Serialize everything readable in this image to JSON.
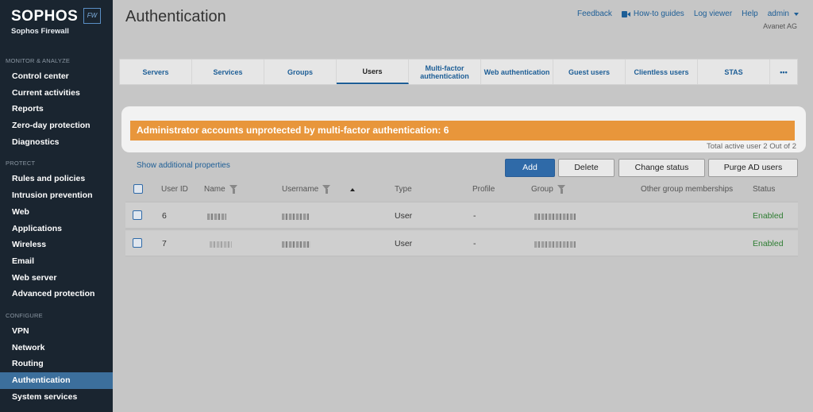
{
  "brand": {
    "name": "SOPHOS",
    "sub": "Sophos Firewall",
    "badge": "FW"
  },
  "sidebar": {
    "sections": [
      {
        "title": "MONITOR & ANALYZE",
        "items": [
          "Control center",
          "Current activities",
          "Reports",
          "Zero-day protection",
          "Diagnostics"
        ]
      },
      {
        "title": "PROTECT",
        "items": [
          "Rules and policies",
          "Intrusion prevention",
          "Web",
          "Applications",
          "Wireless",
          "Email",
          "Web server",
          "Advanced protection"
        ]
      },
      {
        "title": "CONFIGURE",
        "items": [
          "VPN",
          "Network",
          "Routing",
          "Authentication",
          "System services"
        ]
      }
    ],
    "active": "Authentication"
  },
  "header": {
    "title": "Authentication",
    "links": {
      "feedback": "Feedback",
      "howto": "How-to guides",
      "logviewer": "Log viewer",
      "help": "Help",
      "admin": "admin"
    },
    "org": "Avanet AG"
  },
  "tabs": [
    {
      "label": "Servers"
    },
    {
      "label": "Services"
    },
    {
      "label": "Groups"
    },
    {
      "label": "Users"
    },
    {
      "label": "Multi-factor authentication"
    },
    {
      "label": "Web authentication"
    },
    {
      "label": "Guest users"
    },
    {
      "label": "Clientless users"
    },
    {
      "label": "STAS"
    },
    {
      "label": "•••"
    }
  ],
  "alert": {
    "message": "Administrator accounts unprotected by multi-factor authentication: 6",
    "total": "Total active user 2 Out of 2"
  },
  "toolbar": {
    "show_props": "Show additional properties",
    "add": "Add",
    "delete": "Delete",
    "change_status": "Change status",
    "purge": "Purge AD users"
  },
  "table": {
    "headers": {
      "userid": "User ID",
      "name": "Name",
      "username": "Username",
      "type": "Type",
      "profile": "Profile",
      "group": "Group",
      "other": "Other group memberships",
      "status": "Status"
    },
    "rows": [
      {
        "id": "6",
        "type": "User",
        "profile": "-",
        "status": "Enabled"
      },
      {
        "id": "7",
        "type": "User",
        "profile": "-",
        "status": "Enabled"
      }
    ]
  },
  "colors": {
    "accent": "#2f6aa8",
    "alert": "#e8963b",
    "sidebar": "#1a2530",
    "enabled": "#2e7d32"
  }
}
